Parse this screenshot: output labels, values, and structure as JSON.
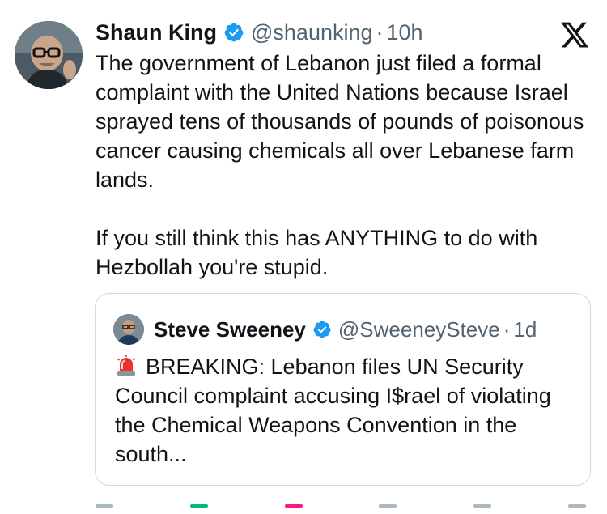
{
  "tweet": {
    "author_name": "Shaun King",
    "author_handle": "@shaunking",
    "separator": "·",
    "time": "10h",
    "text": "The government of Lebanon just filed a formal complaint with the United Nations because Israel sprayed tens of thousands of pounds of poisonous cancer causing chemicals all over Lebanese farm lands.\n\nIf you still think this has ANYTHING to do with Hezbollah you're stupid."
  },
  "quoted_tweet": {
    "author_name": "Steve Sweeney",
    "author_handle": "@SweeneySteve",
    "separator": "·",
    "time": "1d",
    "text": "BREAKING: Lebanon files UN Security Council complaint accusing I$rael of violating the Chemical Weapons Convention in the south..."
  },
  "icons": {
    "verified": "verified-badge-icon",
    "platform": "x-logo-icon",
    "siren": "siren-emoji-icon",
    "actions": [
      "reply-icon",
      "retweet-icon",
      "like-icon",
      "views-icon",
      "bookmark-icon",
      "share-icon"
    ]
  },
  "colors": {
    "verified_blue": "#1d9bf0",
    "secondary_text": "#536471",
    "retweet_green": "#00ba7c",
    "like_pink": "#f91880"
  }
}
